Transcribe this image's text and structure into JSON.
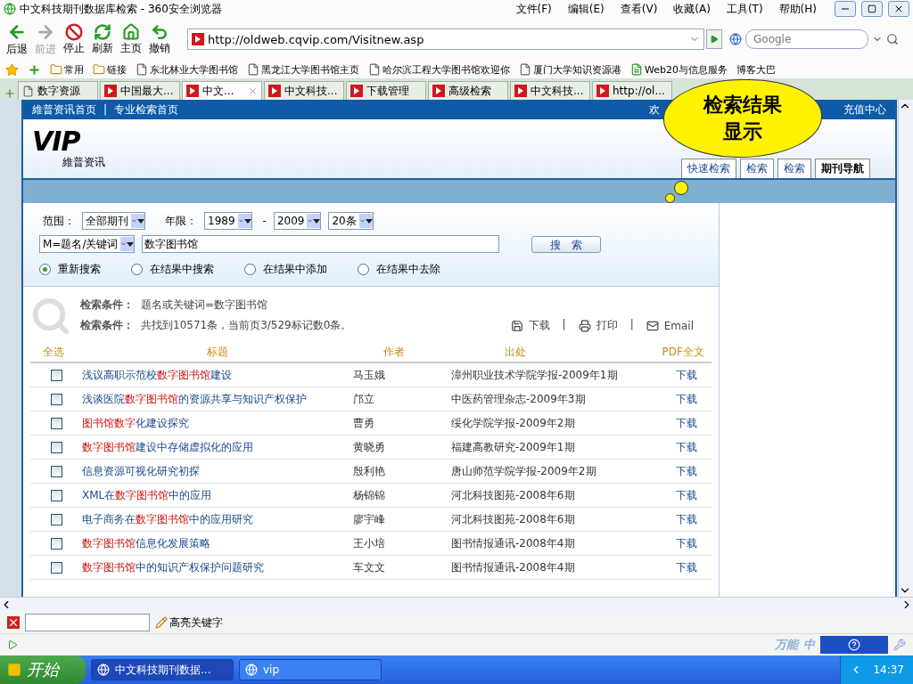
{
  "window": {
    "title": "中文科技期刊数据库检索 - 360安全浏览器",
    "menu": [
      "文件(F)",
      "编辑(E)",
      "查看(V)",
      "收藏(A)",
      "工具(T)",
      "帮助(H)"
    ]
  },
  "toolbar": {
    "buttons": [
      {
        "label": "后退",
        "kind": "back",
        "disabled": false
      },
      {
        "label": "前进",
        "kind": "forward",
        "disabled": true
      },
      {
        "label": "停止",
        "kind": "stop",
        "disabled": false
      },
      {
        "label": "刷新",
        "kind": "refresh",
        "disabled": false
      },
      {
        "label": "主页",
        "kind": "home",
        "disabled": false
      },
      {
        "label": "撤销",
        "kind": "undo",
        "disabled": false
      }
    ],
    "address": "http://oldweb.cqvip.com/Visitnew.asp",
    "search_placeholder": "Google"
  },
  "bookmarks": [
    {
      "label": "常用",
      "kind": "folder"
    },
    {
      "label": "链接",
      "kind": "folder"
    },
    {
      "label": "东北林业大学图书馆",
      "kind": "page"
    },
    {
      "label": "黑龙江大学图书馆主页",
      "kind": "page"
    },
    {
      "label": "哈尔滨工程大学图书馆欢迎你",
      "kind": "page"
    },
    {
      "label": "厦门大学知识资源港",
      "kind": "page"
    },
    {
      "label": "Web20与信息服务",
      "kind": "blog"
    },
    {
      "label": "博客大巴",
      "kind": "text"
    }
  ],
  "tabs": [
    {
      "label": "数字资源",
      "kind": "page",
      "selected": false
    },
    {
      "label": "中国最大...",
      "kind": "vip",
      "selected": false
    },
    {
      "label": "中文...",
      "kind": "vip",
      "selected": true
    },
    {
      "label": "中文科技...",
      "kind": "vip",
      "selected": false
    },
    {
      "label": "下载管理",
      "kind": "vip",
      "selected": false
    },
    {
      "label": "高级检索",
      "kind": "vip",
      "selected": false
    },
    {
      "label": "中文科技...",
      "kind": "vip",
      "selected": false
    },
    {
      "label": "http://ol...",
      "kind": "vip",
      "selected": false
    }
  ],
  "page": {
    "top_links": [
      "維普资讯首页",
      "专业检索首页"
    ],
    "top_right": [
      "欢",
      "充值中心"
    ],
    "logo_mark": "VIP",
    "logo_text": "維普资讯",
    "separator": "|",
    "search_tabs": [
      {
        "label": "快速检索",
        "selected": false
      },
      {
        "label": "检索",
        "selected": false
      },
      {
        "label": "检索",
        "selected": false
      },
      {
        "label": "期刊导航",
        "selected": true
      }
    ],
    "form": {
      "scope_label": "范围：",
      "scope": "全部期刊",
      "year_label": "年限：",
      "year_from": "1989",
      "dash": "-",
      "year_to": "2009",
      "per_page": "20条",
      "field": "M=题名/关键词",
      "query": "数字图书馆",
      "search_button": "搜　索",
      "modes": [
        {
          "label": "重新搜索",
          "selected": true
        },
        {
          "label": "在结果中搜索",
          "selected": false
        },
        {
          "label": "在结果中添加",
          "selected": false
        },
        {
          "label": "在结果中去除",
          "selected": false
        }
      ]
    },
    "conditions": [
      {
        "label": "检索条件：",
        "value": "题名或关键词=数字图书馆"
      },
      {
        "label": "检索条件：",
        "value": "共找到10571条，当前页3/529标记数0条。"
      }
    ],
    "actions": [
      {
        "label": "下载",
        "kind": "save"
      },
      {
        "label": "打印",
        "kind": "print"
      },
      {
        "label": "Email",
        "kind": "mail"
      }
    ],
    "table": {
      "columns": [
        "全选",
        "标题",
        "作者",
        "出处",
        "PDF全文"
      ],
      "rows": [
        {
          "checked": false,
          "title": "浅议高职示范校**数字图书馆**建设",
          "author": "马玉娥",
          "source": "漳州职业技术学院学报-2009年1期",
          "pdf": "下载"
        },
        {
          "checked": false,
          "title": "浅谈医院**数字图书馆**的资源共享与知识产权保护",
          "author": "邝立",
          "source": "中医药管理杂志-2009年3期",
          "pdf": "下载"
        },
        {
          "checked": false,
          "title": "**图书馆数字**化建设探究",
          "author": "曹勇",
          "source": "绥化学院学报-2009年2期",
          "pdf": "下载"
        },
        {
          "checked": false,
          "title": "**数字图书馆**建设中存储虚拟化的应用",
          "author": "黄晓勇",
          "source": "福建高教研究-2009年1期",
          "pdf": "下载"
        },
        {
          "checked": false,
          "title": "信息资源可视化研究初探",
          "author": "殷利艳",
          "source": "唐山师范学院学报-2009年2期",
          "pdf": "下载"
        },
        {
          "checked": false,
          "title": "XML在**数字图书馆**中的应用",
          "author": "杨锦锦",
          "source": "河北科技图苑-2008年6期",
          "pdf": "下载"
        },
        {
          "checked": false,
          "title": "电子商务在**数字图书馆**中的应用研究",
          "author": "廖宇峰",
          "source": "河北科技图苑-2008年6期",
          "pdf": "下载"
        },
        {
          "checked": false,
          "title": "**数字图书馆**信息化发展策略",
          "author": "王小培",
          "source": "图书情报通讯-2008年4期",
          "pdf": "下载"
        },
        {
          "checked": false,
          "title": "**数字图书馆**中的知识产权保护问题研究",
          "author": "车文文",
          "source": "图书情报通讯-2008年4期",
          "pdf": "下载"
        }
      ]
    }
  },
  "callout": [
    "检索结果",
    "显示"
  ],
  "find_bar": {
    "label": "高亮关键字"
  },
  "status_bar": {
    "items": [
      "万能",
      "中"
    ]
  },
  "taskbar": {
    "start": "开始",
    "windows": [
      {
        "label": "中文科技期刊数据...",
        "selected": true
      },
      {
        "label": "vip",
        "selected": false
      }
    ],
    "clock": "14:37"
  }
}
